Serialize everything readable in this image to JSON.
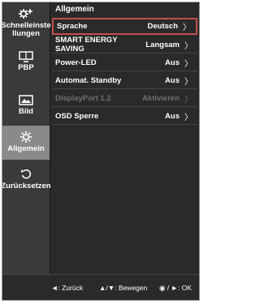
{
  "sidebar": {
    "items": [
      {
        "label": "Schnelleinstellungen",
        "line1": "Schnelleinste",
        "line2": "llungen",
        "icon": "settings-sparkle-icon"
      },
      {
        "label": "PBP",
        "icon": "monitor-icon"
      },
      {
        "label": "Bild",
        "icon": "picture-icon"
      },
      {
        "label": "Allgemein",
        "icon": "gear-icon",
        "active": true
      },
      {
        "label": "Zurücksetzen",
        "icon": "reset-icon"
      }
    ]
  },
  "main": {
    "heading": "Allgemein",
    "rows": [
      {
        "label": "Sprache",
        "value": "Deutsch",
        "selected": true
      },
      {
        "label": "SMART ENERGY SAVING",
        "value": "Langsam"
      },
      {
        "label": "Power-LED",
        "value": "Aus"
      },
      {
        "label": "Automat. Standby",
        "value": "Aus"
      },
      {
        "label": "DisplayPort 1.2",
        "value": "Aktivieren",
        "disabled": true
      },
      {
        "label": "OSD Sperre",
        "value": "Aus"
      }
    ]
  },
  "footer": {
    "back": "◄: Zurück",
    "move": "▲/▼: Bewegen",
    "ok": "◉ / ►: OK"
  },
  "colors": {
    "background": "#2a2a2a",
    "sidebar": "#3a3a3a",
    "active_item": "#8a8a8a",
    "selection_border": "#c0504d",
    "disabled_text": "#6e6e6e"
  }
}
